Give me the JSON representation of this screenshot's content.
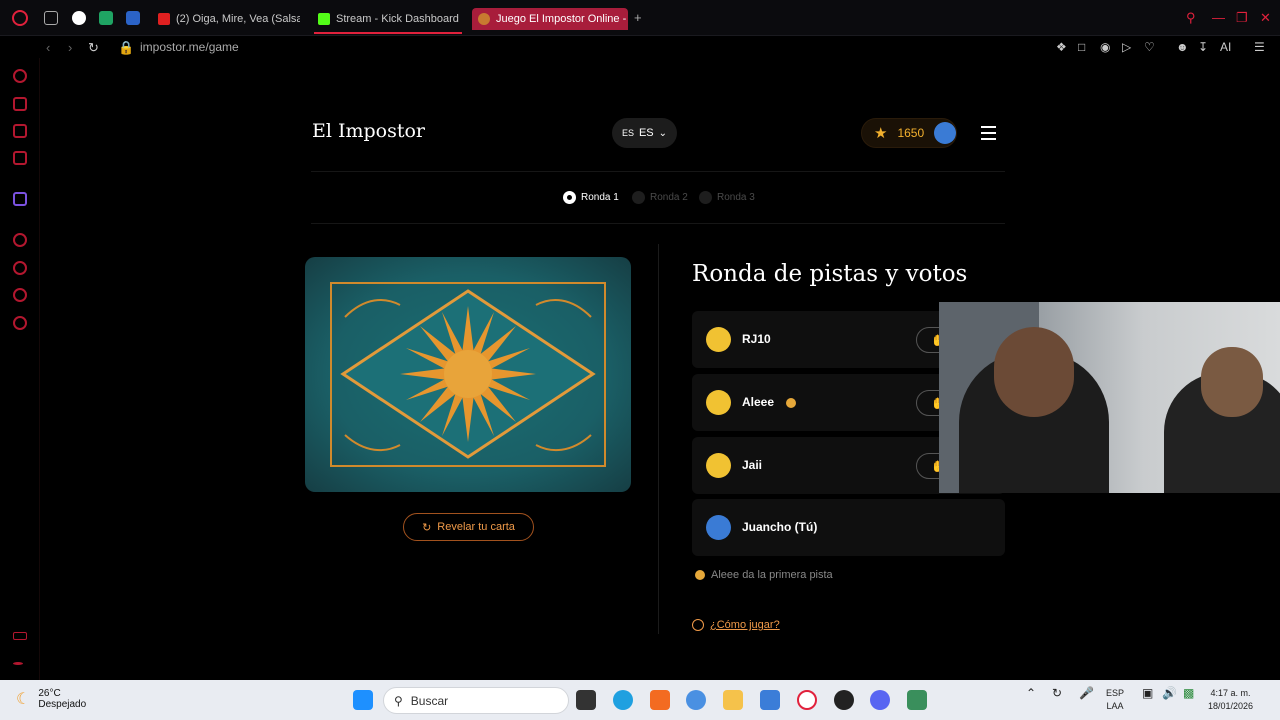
{
  "browser": {
    "tabs": [
      {
        "label": "(2) Oiga, Mire, Vea (Salsa)",
        "favicon_color": "#e02020"
      },
      {
        "label": "Stream - Kick Dashboard",
        "favicon_color": "#53fc18"
      },
      {
        "label": "Juego El Impostor Online -",
        "favicon_color": "#c87a30",
        "active": true
      }
    ],
    "new_tab": "+",
    "url": "impostor.me/game",
    "toolbar_right": "AI"
  },
  "header": {
    "logo": "El Impostor",
    "lang_prefix": "ES",
    "lang_value": "ES",
    "score": "1650"
  },
  "rounds": [
    {
      "label": "Ronda 1",
      "active": true
    },
    {
      "label": "Ronda 2",
      "active": false
    },
    {
      "label": "Ronda 3",
      "active": false
    }
  ],
  "card": {
    "reveal_button": "Revelar tu carta"
  },
  "game": {
    "heading": "Ronda de pistas y votos",
    "players": [
      {
        "name": "RJ10",
        "avatar_color": "#f1c232",
        "clue_giver": false,
        "vote_icon": "✋"
      },
      {
        "name": "Aleee",
        "avatar_color": "#f1c232",
        "clue_giver": true,
        "vote_icon": "✋"
      },
      {
        "name": "Jaii",
        "avatar_color": "#f1c232",
        "clue_giver": false,
        "vote_icon": "✋"
      },
      {
        "name": "Juancho (Tú)",
        "avatar_color": "#3a7bd5",
        "clue_giver": false,
        "vote_icon": ""
      }
    ],
    "hint": "Aleee da la primera pista",
    "how_to_play": "¿Cómo jugar?"
  },
  "taskbar": {
    "temp": "26°C",
    "weather": "Despejado",
    "search_placeholder": "Buscar",
    "lang_top": "ESP",
    "lang_bottom": "LAA",
    "time": "4:17 a. m.",
    "date": "18/01/2026"
  },
  "colors": {
    "accent": "#e1213c",
    "orange": "#f09a49",
    "gold": "#f2b02e"
  }
}
